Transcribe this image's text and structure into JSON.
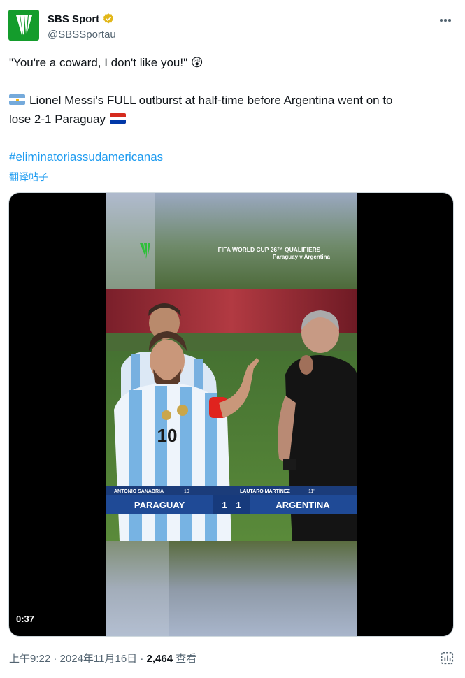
{
  "account": {
    "display_name": "SBS Sport",
    "handle": "@SBSSportau",
    "verified": true,
    "brand_color": "#149c2c"
  },
  "tweet": {
    "line1": "\"You're a coward, I don't like you!\" 😲",
    "line2": "Lionel Messi's FULL outburst at half-time before Argentina went on to",
    "line3": "lose 2-1 Paraguay",
    "hashtag": "#eliminatoriassudamericanas",
    "translate_label": "翻译帖子"
  },
  "video": {
    "duration": "0:37",
    "overlay_title": "FIFA WORLD CUP 26™ QUALIFIERS",
    "overlay_subtitle": "Paraguay v Argentina",
    "scorebar": {
      "left_player": "ANTONIO SANABRIA",
      "left_number": "19",
      "right_player": "LAUTARO MARTÍNEZ",
      "right_number": "11'",
      "home_team": "PARAGUAY",
      "home_score": "1",
      "away_score": "1",
      "away_team": "ARGENTINA"
    },
    "shirt_number": "10"
  },
  "meta": {
    "time": "上午9:22",
    "sep1": "·",
    "date": "2024年11月16日",
    "sep2": "·",
    "views": "2,464",
    "views_label": "查看"
  }
}
